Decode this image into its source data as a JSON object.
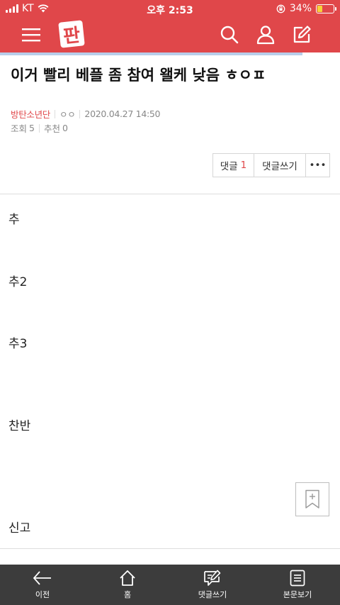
{
  "status_bar": {
    "carrier": "KT",
    "time": "오후 2:53",
    "battery": "34%",
    "battery_level": 0.34
  },
  "header": {
    "logo_text": "판",
    "accent_color": "#e0474a"
  },
  "reading_progress": 0.89,
  "article": {
    "title": "이거 빨리 베플 좀 참여 왤케 낮음 ㅎㅇㅍ",
    "category": "방탄소년단",
    "author": "ㅇㅇ",
    "datetime": "2020.04.27 14:50",
    "views_label": "조회",
    "views": "5",
    "likes_label": "추천",
    "likes": "0"
  },
  "actions": {
    "comment_label": "댓글",
    "comment_count": "1",
    "write_comment_label": "댓글쓰기",
    "more_label": "•••"
  },
  "body_lines": [
    "추",
    "추2",
    "추3",
    "찬반"
  ],
  "report_label": "신고",
  "bottom_nav": {
    "items": [
      {
        "label": "이전",
        "icon": "back-arrow-icon"
      },
      {
        "label": "홈",
        "icon": "home-icon"
      },
      {
        "label": "댓글쓰기",
        "icon": "comment-write-icon"
      },
      {
        "label": "본문보기",
        "icon": "article-view-icon"
      }
    ]
  }
}
